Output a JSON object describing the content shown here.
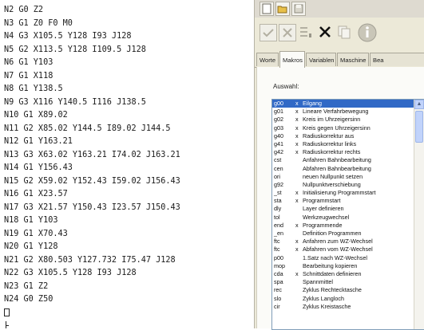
{
  "editor": {
    "lines": [
      "N2 G0 Z2",
      "N3 G1 Z0 F0 M0",
      "N4 G3 X105.5 Y128 I93 J128",
      "N5 G2 X113.5 Y128 I109.5 J128",
      "N6 G1 Y103",
      "N7 G1 X118",
      "N8 G1 Y138.5",
      "N9 G3 X116 Y140.5 I116 J138.5",
      "N10 G1 X89.02",
      "N11 G2 X85.02 Y144.5 I89.02 J144.5",
      "N12 G1 Y163.21",
      "N13 G3 X63.02 Y163.21 I74.02 J163.21",
      "N14 G1 Y156.43",
      "N15 G2 X59.02 Y152.43 I59.02 J156.43",
      "N16 G1 X23.57",
      "N17 G3 X21.57 Y150.43 I23.57 J150.43",
      "N18 G1 Y103",
      "N19 G1 X70.43",
      "N20 G1 Y128",
      "N21 G2 X80.503 Y127.732 I75.47 J128",
      "N22 G3 X105.5 Y128 I93 J128",
      "N23 G1 Z2",
      "N24 G0 Z50"
    ]
  },
  "toolwindow": {
    "tabs": [
      "Worte",
      "Makros",
      "Variablen",
      "Maschine",
      "Bea"
    ],
    "active_tab": "Makros",
    "auswahl_label": "Auswahl:",
    "macros": [
      {
        "code": "g00",
        "flag": "x",
        "desc": "Eilgang"
      },
      {
        "code": "g01",
        "flag": "x",
        "desc": "Lineare Verfahrbewegung"
      },
      {
        "code": "g02",
        "flag": "x",
        "desc": "Kreis im Uhrzeigersinn"
      },
      {
        "code": "g03",
        "flag": "x",
        "desc": "Kreis gegen Uhrzeigersinn"
      },
      {
        "code": "g40",
        "flag": "x",
        "desc": "Radiuskorrektur aus"
      },
      {
        "code": "g41",
        "flag": "x",
        "desc": "Radiuskorrektur links"
      },
      {
        "code": "g42",
        "flag": "x",
        "desc": "Radiuskorrektur rechts"
      },
      {
        "code": "cst",
        "flag": "",
        "desc": "Anfahren Bahnbearbeitung"
      },
      {
        "code": "cen",
        "flag": "",
        "desc": "Abfahren Bahnbearbeitung"
      },
      {
        "code": "ori",
        "flag": "",
        "desc": "neuen Nullpunkt setzen"
      },
      {
        "code": "g92",
        "flag": "",
        "desc": "Nullpunktverschiebung"
      },
      {
        "code": "_st",
        "flag": "x",
        "desc": "Initialisierung Programmstart"
      },
      {
        "code": "sta",
        "flag": "x",
        "desc": "Programmstart"
      },
      {
        "code": "dly",
        "flag": "",
        "desc": "Layer definieren"
      },
      {
        "code": "tol",
        "flag": "",
        "desc": "Werkzeugwechsel"
      },
      {
        "code": "end",
        "flag": "x",
        "desc": "Programmende"
      },
      {
        "code": "_en",
        "flag": "",
        "desc": "Definition Programmen"
      },
      {
        "code": "ftc",
        "flag": "x",
        "desc": "Anfahren zum WZ-Wechsel"
      },
      {
        "code": "ftc",
        "flag": "x",
        "desc": "Abfahren vom WZ-Wechsel"
      },
      {
        "code": "p00",
        "flag": "",
        "desc": "1.Satz nach WZ-Wechsel"
      },
      {
        "code": "mop",
        "flag": "",
        "desc": "Bearbeitung kopieren"
      },
      {
        "code": "cda",
        "flag": "x",
        "desc": "Schnittdaten definieren"
      },
      {
        "code": "spa",
        "flag": "",
        "desc": "Spannmittel"
      },
      {
        "code": "rec",
        "flag": "",
        "desc": "Zyklus Rechtecktasche"
      },
      {
        "code": "slo",
        "flag": "",
        "desc": "Zyklus Langloch"
      },
      {
        "code": "cir",
        "flag": "",
        "desc": "Zyklus Kreistasche"
      }
    ],
    "selected_index": 0,
    "colors": {
      "selection": "#3169c6",
      "panel": "#ece9d8"
    }
  }
}
